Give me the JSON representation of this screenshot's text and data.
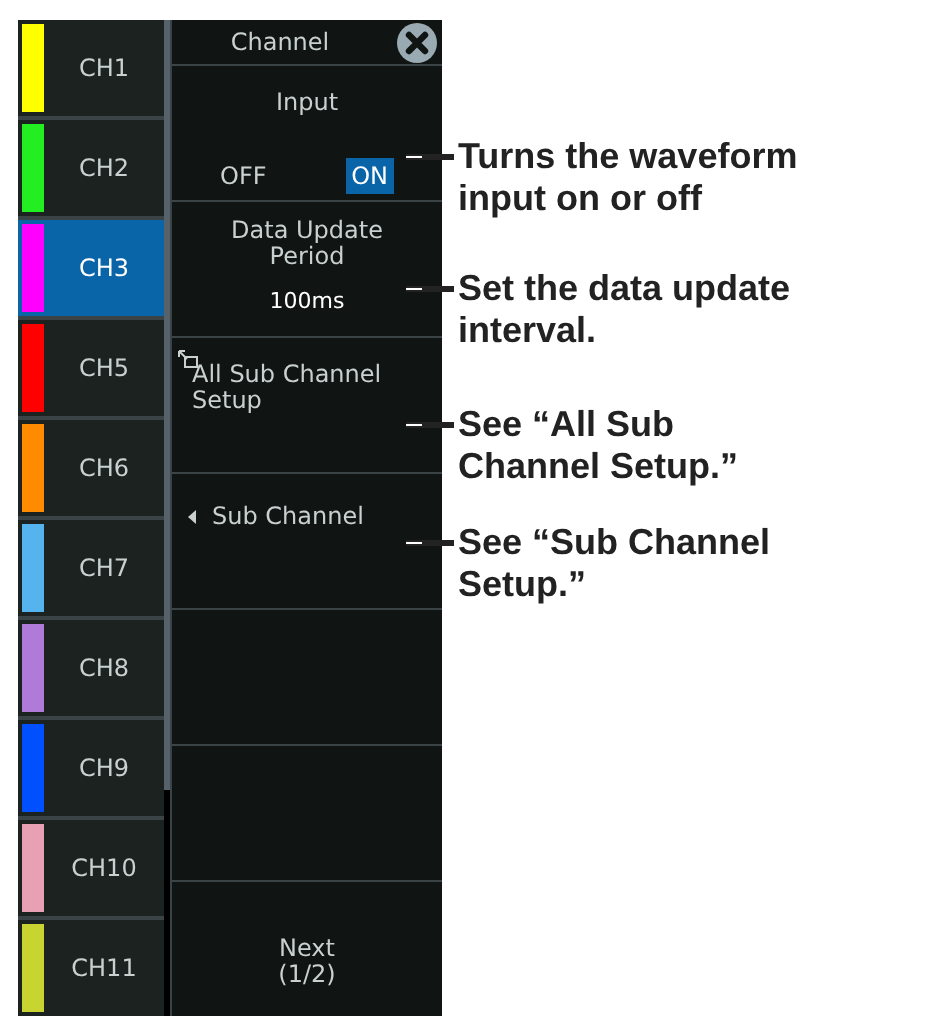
{
  "channels": [
    {
      "label": "CH1",
      "color": "#ffff00",
      "selected": false
    },
    {
      "label": "CH2",
      "color": "#22ee22",
      "selected": false
    },
    {
      "label": "CH3",
      "color": "#ff00ff",
      "selected": true
    },
    {
      "label": "CH5",
      "color": "#ff0000",
      "selected": false
    },
    {
      "label": "CH6",
      "color": "#ff8c00",
      "selected": false
    },
    {
      "label": "CH7",
      "color": "#55b4ee",
      "selected": false
    },
    {
      "label": "CH8",
      "color": "#b07ad8",
      "selected": false
    },
    {
      "label": "CH9",
      "color": "#0050ff",
      "selected": false
    },
    {
      "label": "CH10",
      "color": "#e8a0b4",
      "selected": false
    },
    {
      "label": "CH11",
      "color": "#c8d430",
      "selected": false
    }
  ],
  "menu": {
    "title": "Channel",
    "items": [
      {
        "kind": "toggle",
        "label": "Input",
        "options": [
          {
            "label": "OFF",
            "selected": false
          },
          {
            "label": "ON",
            "selected": true
          }
        ]
      },
      {
        "kind": "value",
        "label": "Data Update Period",
        "value": "100ms"
      },
      {
        "kind": "dialog",
        "label": "All Sub Channel Setup"
      },
      {
        "kind": "submenu",
        "label": "Sub Channel"
      },
      {
        "kind": "empty"
      },
      {
        "kind": "empty"
      },
      {
        "kind": "next",
        "label": "Next (1/2)"
      }
    ]
  },
  "callouts": [
    {
      "text": "Turns the waveform input on or off"
    },
    {
      "text": "Set the data update interval."
    },
    {
      "text": "See “All Sub Channel Setup.”"
    },
    {
      "text": "See “Sub Channel Setup.”"
    }
  ]
}
